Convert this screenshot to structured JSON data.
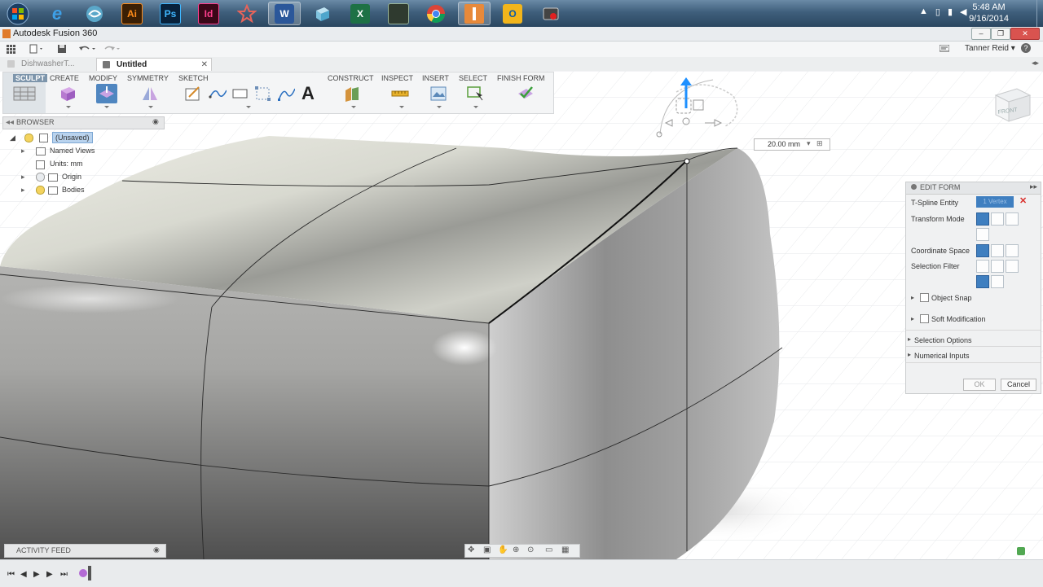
{
  "taskbar": {
    "apps": [
      {
        "name": "windows-start-icon",
        "label": ""
      },
      {
        "name": "internet-explorer-icon",
        "label": "e"
      },
      {
        "name": "app-swirl-icon",
        "label": ""
      },
      {
        "name": "illustrator-icon",
        "label": "Ai"
      },
      {
        "name": "photoshop-icon",
        "label": "Ps"
      },
      {
        "name": "indesign-icon",
        "label": "Id"
      },
      {
        "name": "app-star-icon",
        "label": ""
      },
      {
        "name": "word-icon",
        "label": "W"
      },
      {
        "name": "app-cube-icon",
        "label": ""
      },
      {
        "name": "excel-icon",
        "label": "X"
      },
      {
        "name": "app-dark-icon",
        "label": ""
      },
      {
        "name": "chrome-icon",
        "label": ""
      },
      {
        "name": "fusion360-icon",
        "label": ""
      },
      {
        "name": "outlook-icon",
        "label": "O"
      },
      {
        "name": "app-screencast-icon",
        "label": ""
      }
    ],
    "time": "5:48 AM",
    "date": "9/16/2014"
  },
  "window": {
    "title": "Autodesk Fusion 360"
  },
  "toolbar": {
    "user": "Tanner Reid",
    "user_caret": "▾",
    "help": "?"
  },
  "tabs": [
    {
      "label": "DishwasherT...",
      "active": false
    },
    {
      "label": "Untitled",
      "active": true
    }
  ],
  "ribbon": {
    "workspace": "SCULPT",
    "groups": [
      "CREATE",
      "MODIFY",
      "SYMMETRY",
      "SKETCH",
      "CONSTRUCT",
      "INSPECT",
      "INSERT",
      "SELECT",
      "FINISH FORM"
    ],
    "sketch_text_glyph": "A"
  },
  "browser": {
    "title": "BROWSER",
    "items": [
      "(Unsaved)",
      "Named Views",
      "Units: mm",
      "Origin",
      "Bodies"
    ]
  },
  "dimension": {
    "value": "20.00 mm"
  },
  "view_cube": {
    "face": "FRONT"
  },
  "edit_form": {
    "title": "EDIT FORM",
    "rows": {
      "tspline_entity": "T-Spline Entity",
      "transform_mode": "Transform Mode",
      "coordinate_space": "Coordinate Space",
      "selection_filter": "Selection Filter",
      "object_snap": "Object Snap",
      "soft_modification": "Soft Modification",
      "selection_options": "Selection Options",
      "numerical_inputs": "Numerical Inputs"
    },
    "entity_value": "1 Vertex",
    "ok": "OK",
    "cancel": "Cancel",
    "accent": "#3f7fc0"
  },
  "activity_feed": {
    "title": "ACTIVITY FEED"
  }
}
